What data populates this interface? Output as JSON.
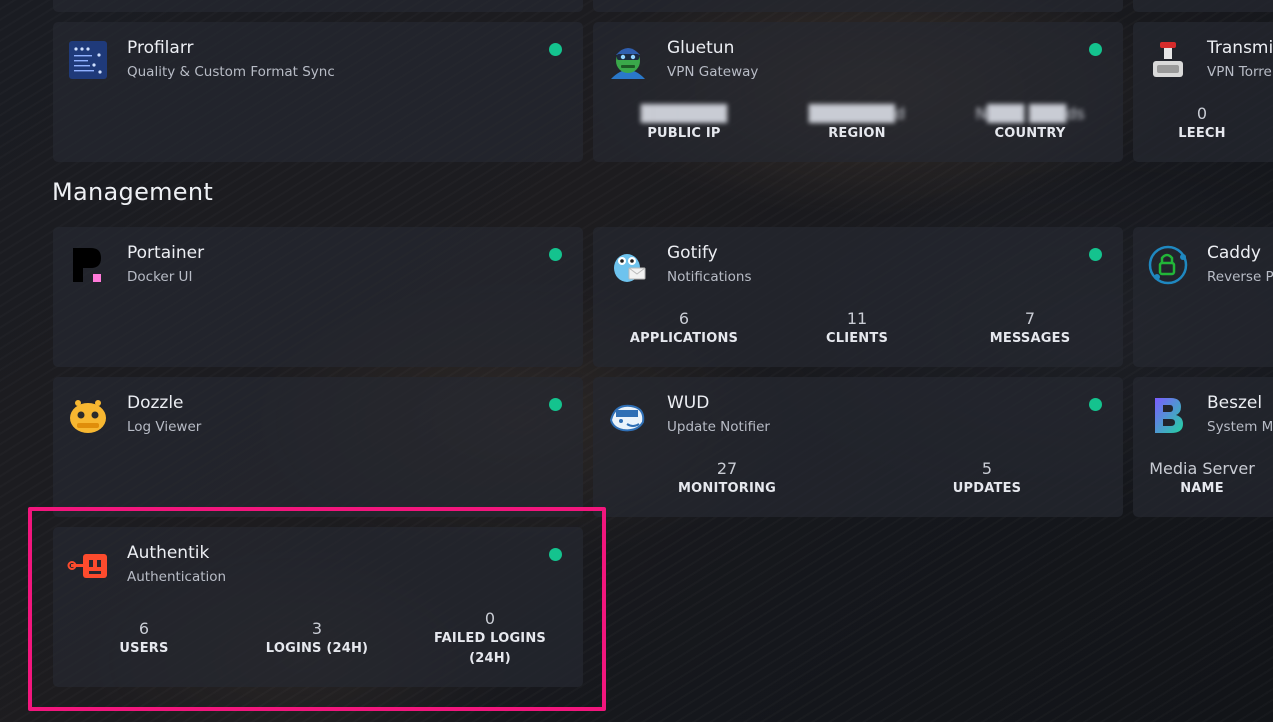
{
  "section": {
    "title": "Management"
  },
  "colors": {
    "status_online": "#14c38e",
    "highlight": "#f2167d"
  },
  "services": {
    "profilarr": {
      "name": "Profilarr",
      "description": "Quality & Custom Format Sync",
      "icon": "profilarr-icon"
    },
    "gluetun": {
      "name": "Gluetun",
      "description": "VPN Gateway",
      "icon": "gluetun-icon",
      "stats": [
        {
          "value": "███████",
          "label": "PUBLIC IP"
        },
        {
          "value": "███████d",
          "label": "REGION"
        },
        {
          "value": "N███ ███ds",
          "label": "COUNTRY"
        }
      ]
    },
    "transmission": {
      "name": "Transmi",
      "description": "VPN Torre",
      "icon": "transmission-icon",
      "stats": [
        {
          "value": "0",
          "label": "LEECH"
        }
      ]
    },
    "portainer": {
      "name": "Portainer",
      "description": "Docker UI",
      "icon": "portainer-icon"
    },
    "gotify": {
      "name": "Gotify",
      "description": "Notifications",
      "icon": "gotify-icon",
      "stats": [
        {
          "value": "6",
          "label": "APPLICATIONS"
        },
        {
          "value": "11",
          "label": "CLIENTS"
        },
        {
          "value": "7",
          "label": "MESSAGES"
        }
      ]
    },
    "caddy": {
      "name": "Caddy",
      "description": "Reverse P",
      "icon": "caddy-icon"
    },
    "dozzle": {
      "name": "Dozzle",
      "description": "Log Viewer",
      "icon": "dozzle-icon"
    },
    "wud": {
      "name": "WUD",
      "description": "Update Notifier",
      "icon": "wud-icon",
      "stats": [
        {
          "value": "27",
          "label": "MONITORING"
        },
        {
          "value": "5",
          "label": "UPDATES"
        }
      ]
    },
    "beszel": {
      "name": "Beszel",
      "description": "System M",
      "icon": "beszel-icon",
      "stats": [
        {
          "value": "Media Server",
          "label": "NAME"
        }
      ]
    },
    "authentik": {
      "name": "Authentik",
      "description": "Authentication",
      "icon": "authentik-icon",
      "stats": [
        {
          "value": "6",
          "label": "USERS"
        },
        {
          "value": "3",
          "label": "LOGINS (24H)"
        },
        {
          "value": "0",
          "label": "FAILED LOGINS",
          "label2": "(24H)"
        }
      ]
    }
  }
}
